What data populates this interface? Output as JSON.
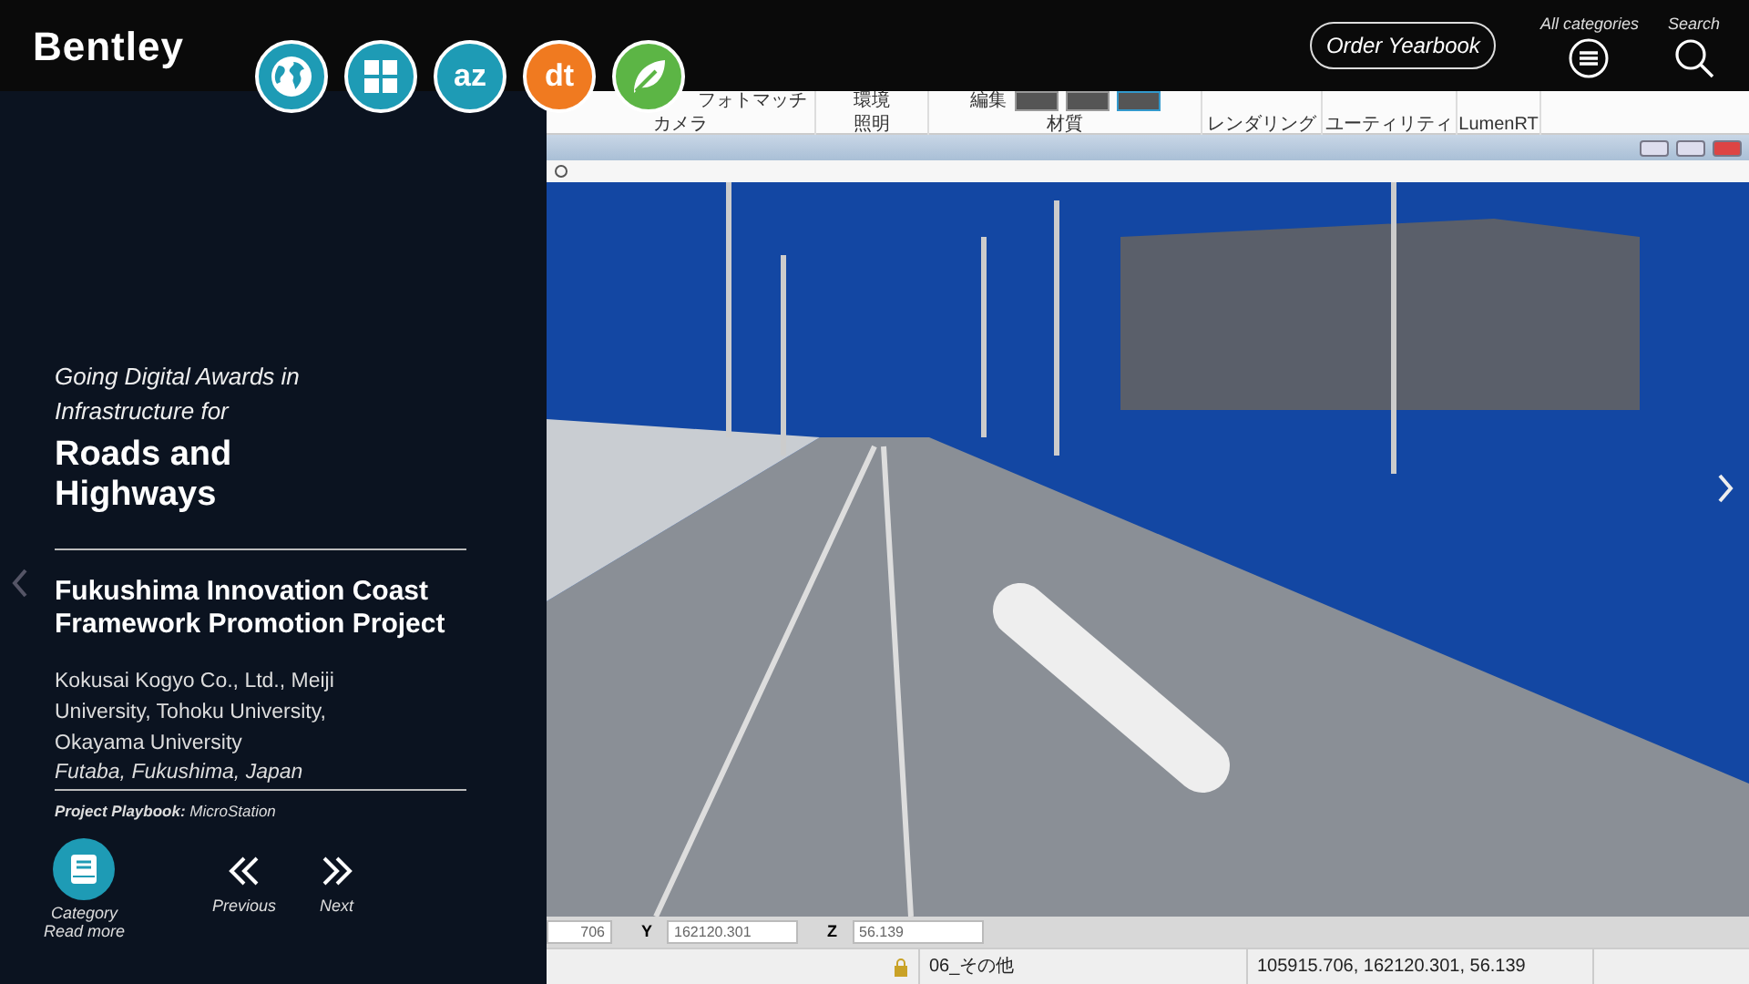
{
  "header": {
    "logo": "Bentley",
    "app_icons": [
      {
        "kind": "globe",
        "color": "#1e9bb5"
      },
      {
        "kind": "grid",
        "color": "#1e9bb5"
      },
      {
        "kind": "letters",
        "text": "az",
        "color": "#1e9bb5"
      },
      {
        "kind": "letters",
        "text": "dt",
        "color": "#f07a20"
      },
      {
        "kind": "leaf",
        "color": "#5cb545"
      }
    ],
    "order_button": "Order Yearbook",
    "categories_label": "All categories",
    "search_label": "Search"
  },
  "story": {
    "intro": "*Going Digital Awards in Infrastructure* for",
    "category": "Roads and Highways",
    "project": "Fukushima Innovation Coast Framework Promotion Project",
    "organizations": "Kokusai Kogyo Co., Ltd., Meiji University, Tohoku University, Okayama University",
    "location": "Futaba, Fukushima, Japan",
    "playbook": "**Project Playbook:** MicroStation",
    "category_button": {
      "label": "Category",
      "caption": "Read more"
    },
    "previous": "Previous",
    "next": "Next"
  },
  "app": {
    "ribbon_buttons": [
      "フォトマッチ",
      "環境",
      "編集"
    ],
    "ribbon_groups": [
      "カメラ",
      "照明",
      "材質",
      "レンダリング",
      "ユーティリティ",
      "LumenRT"
    ],
    "coords": [
      {
        "value": "706"
      },
      {
        "label": "Y",
        "value": "162120.301"
      },
      {
        "label": "Z",
        "value": "56.139"
      }
    ],
    "status": {
      "level_name": "06_その他",
      "position": "105915.706, 162120.301, 56.139"
    }
  }
}
